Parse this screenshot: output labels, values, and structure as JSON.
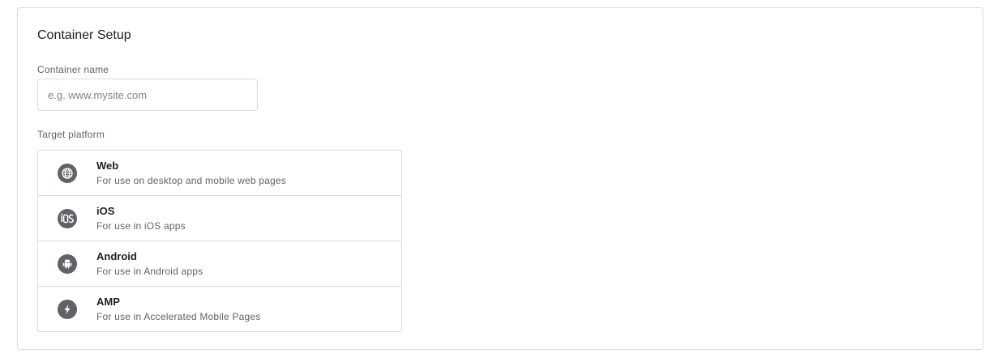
{
  "card": {
    "title": "Container Setup"
  },
  "container_name": {
    "label": "Container name",
    "value": "",
    "placeholder": "e.g. www.mysite.com"
  },
  "target_platform": {
    "label": "Target platform",
    "options": [
      {
        "name": "Web",
        "description": "For use on desktop and mobile web pages",
        "icon": "globe-icon"
      },
      {
        "name": "iOS",
        "description": "For use in iOS apps",
        "icon": "ios-icon"
      },
      {
        "name": "Android",
        "description": "For use in Android apps",
        "icon": "android-icon"
      },
      {
        "name": "AMP",
        "description": "For use in Accelerated Mobile Pages",
        "icon": "amp-bolt-icon"
      }
    ]
  },
  "colors": {
    "border": "#dadce0",
    "icon_background": "#5f6368",
    "text_primary": "#202124",
    "text_secondary": "#5f6368"
  }
}
